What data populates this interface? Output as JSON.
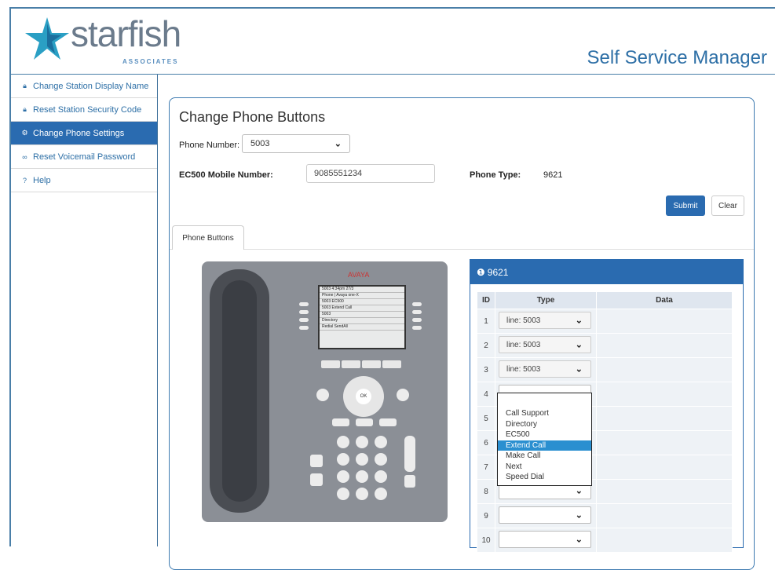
{
  "header": {
    "logo_text": "starfish",
    "logo_sub": "ASSOCIATES",
    "app_title": "Self Service Manager"
  },
  "sidebar": {
    "items": [
      {
        "label": "Change Station Display Name",
        "icon": "lock-icon"
      },
      {
        "label": "Reset Station Security Code",
        "icon": "lock-icon"
      },
      {
        "label": "Change Phone Settings",
        "icon": "gear-icon",
        "active": true
      },
      {
        "label": "Reset Voicemail Password",
        "icon": "voicemail-icon"
      },
      {
        "label": "Help",
        "icon": "help-icon"
      }
    ]
  },
  "form": {
    "title": "Change Phone Buttons",
    "phone_number_label": "Phone Number:",
    "phone_number_value": "5003",
    "ec500_label": "EC500 Mobile Number:",
    "ec500_value": "9085551234",
    "phone_type_label": "Phone Type:",
    "phone_type_value": "9621",
    "submit_label": "Submit",
    "clear_label": "Clear",
    "tab_label": "Phone Buttons"
  },
  "phone_image": {
    "brand": "AVAYA",
    "screen_lines": [
      "5003    4:34pm  27/3",
      "Phone | Avaya one-X",
      "5003          EC500",
      "5003     Extend Call",
      "5003",
      "Directory",
      "Redial  SendAll"
    ]
  },
  "buttons_panel": {
    "title": "9621",
    "columns": [
      "ID",
      "Type",
      "Data"
    ],
    "rows": [
      {
        "id": "1",
        "type": "line: 5003"
      },
      {
        "id": "2",
        "type": "line: 5003"
      },
      {
        "id": "3",
        "type": "line: 5003"
      },
      {
        "id": "4",
        "type": ""
      },
      {
        "id": "5",
        "type": ""
      },
      {
        "id": "6",
        "type": ""
      },
      {
        "id": "7",
        "type": ""
      },
      {
        "id": "8",
        "type": ""
      },
      {
        "id": "9",
        "type": ""
      },
      {
        "id": "10",
        "type": ""
      }
    ],
    "dropdown_options": [
      "Call Support",
      "Directory",
      "EC500",
      "Extend Call",
      "Make Call",
      "Next",
      "Speed Dial"
    ],
    "dropdown_selected": "Extend Call"
  },
  "colors": {
    "accent": "#2a6bb0",
    "highlight": "#2a8fd0",
    "brand": "#2d6fa6"
  }
}
